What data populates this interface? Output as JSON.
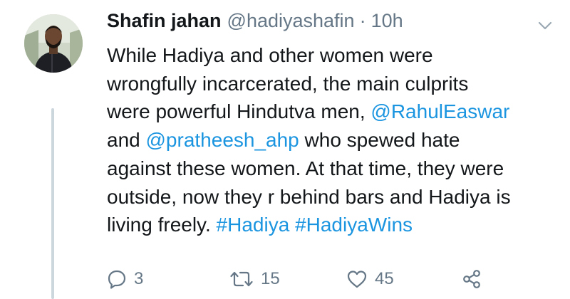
{
  "tweet": {
    "author_name": "Shafin jahan",
    "handle": "@hadiyashafin",
    "separator": "·",
    "time": "10h",
    "lines": [
      [
        {
          "t": "While Hadiya and other women were"
        }
      ],
      [
        {
          "t": "wrongfully incarcerated, the main culprits"
        }
      ],
      [
        {
          "t": "were powerful Hindutva men, "
        },
        {
          "t": "@RahulEaswar",
          "link": true
        }
      ],
      [
        {
          "t": "and "
        },
        {
          "t": "@pratheesh_ahp",
          "link": true
        },
        {
          "t": " who spewed hate"
        }
      ],
      [
        {
          "t": "against these women. At that time, they were"
        }
      ],
      [
        {
          "t": "outside, now they r behind bars and Hadiya is"
        }
      ],
      [
        {
          "t": "living freely. "
        },
        {
          "t": "#Hadiya",
          "link": true
        },
        {
          "t": " "
        },
        {
          "t": "#HadiyaWins",
          "link": true
        }
      ]
    ]
  },
  "actions": {
    "reply_count": "3",
    "retweet_count": "15",
    "like_count": "45"
  },
  "colors": {
    "link": "#1b95e0",
    "muted": "#657786",
    "text": "#14171a"
  },
  "icons": [
    "avatar",
    "chevron-down-icon",
    "reply-icon",
    "retweet-icon",
    "like-icon",
    "share-icon"
  ]
}
